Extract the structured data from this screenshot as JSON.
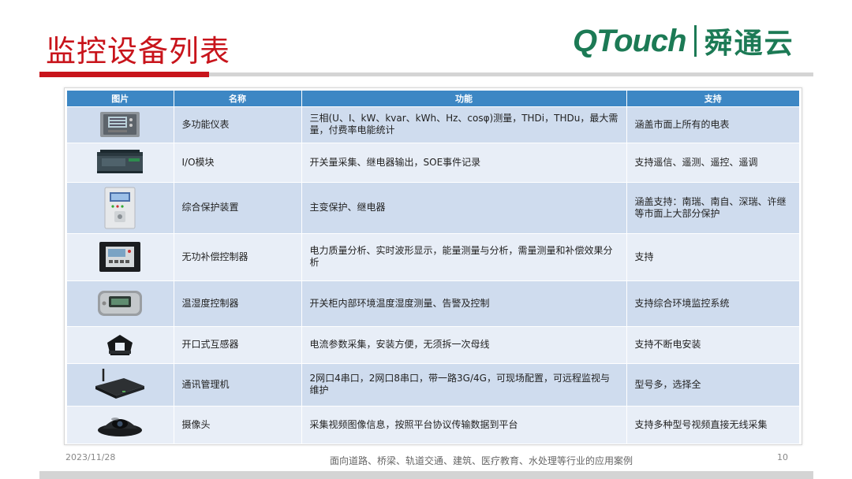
{
  "slide": {
    "title": "监控设备列表",
    "logo_text": "QTouch",
    "logo_cn": "舜通云"
  },
  "table": {
    "headers": {
      "image": "图片",
      "name": "名称",
      "function": "功能",
      "support": "支持"
    },
    "rows": [
      {
        "icon": "power-meter-icon",
        "name": "多功能仪表",
        "function": "三相(U、I、kW、kvar、kWh、Hz、cosφ)测量，THDi，THDu，最大需量，付费率电能统计",
        "support": "涵盖市面上所有的电表"
      },
      {
        "icon": "io-module-icon",
        "name": "I/O模块",
        "function": "开关量采集、继电器输出，SOE事件记录",
        "support": "支持遥信、遥测、遥控、遥调"
      },
      {
        "icon": "protection-device-icon",
        "name": "综合保护装置",
        "function": "主变保护、继电器",
        "support": "涵盖支持：南瑞、南自、深瑞、许继等市面上大部分保护"
      },
      {
        "icon": "reactive-controller-icon",
        "name": "无功补偿控制器",
        "function": "电力质量分析、实时波形显示，能量测量与分析，需量测量和补偿效果分析",
        "support": "支持"
      },
      {
        "icon": "humidity-controller-icon",
        "name": "温湿度控制器",
        "function": "开关柜内部环境温度湿度测量、告警及控制",
        "support": "支持综合环境监控系统"
      },
      {
        "icon": "split-ct-icon",
        "name": "开口式互感器",
        "function": "电流参数采集，安装方便，无须拆一次母线",
        "support": "支持不断电安装"
      },
      {
        "icon": "comm-manager-icon",
        "name": "通讯管理机",
        "function": "2网口4串口，2网口8串口，带一路3G/4G，可现场配置，可远程监视与维护",
        "support": "型号多，选择全"
      },
      {
        "icon": "camera-icon",
        "name": "摄像头",
        "function": "采集视频图像信息，按照平台协议传输数据到平台",
        "support": "支持多种型号视频直接无线采集"
      }
    ]
  },
  "footer": {
    "date": "2023/11/28",
    "text": "面向道路、桥梁、轨道交通、建筑、医疗教育、水处理等行业的应用案例",
    "page": "10"
  },
  "colors": {
    "title_red": "#c8141b",
    "header_blue": "#3d87c4",
    "logo_green": "#1c7a55"
  }
}
